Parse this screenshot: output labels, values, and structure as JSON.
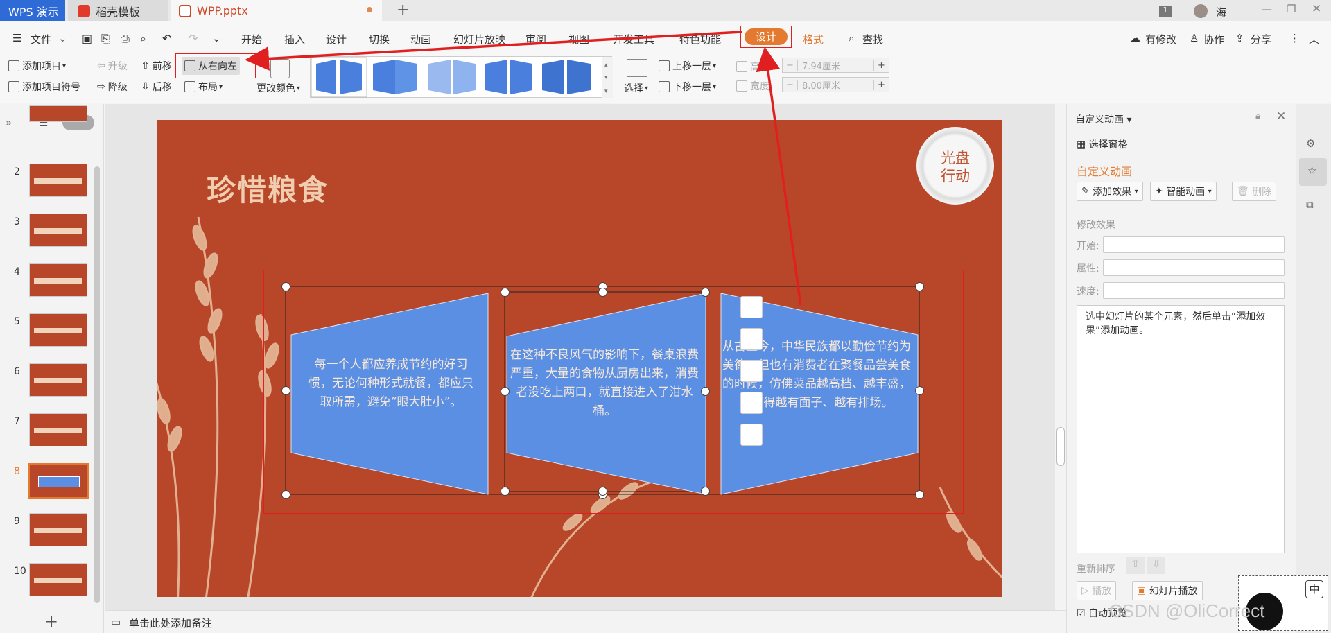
{
  "tabs": [
    {
      "label": "WPS 演示"
    },
    {
      "label": "稻壳模板"
    },
    {
      "label": "WPP.pptx"
    }
  ],
  "titlebar": {
    "counter": "1",
    "user": "海"
  },
  "menu": {
    "file": "文件",
    "items": [
      "开始",
      "插入",
      "设计",
      "切换",
      "动画",
      "幻灯片放映",
      "审阅",
      "视图",
      "开发工具",
      "特色功能"
    ],
    "active_design": "设计",
    "format": "格式",
    "search": "查找",
    "right": [
      "有修改",
      "协作",
      "分享"
    ]
  },
  "ribbon": {
    "add_item": "添加项目",
    "add_bullet": "添加项目符号",
    "upgrade": "升级",
    "downgrade": "降级",
    "forward": "前移",
    "backward": "后移",
    "rtl": "从右向左",
    "layout": "布局",
    "change_color": "更改颜色",
    "select": "选择",
    "up_layer": "上移一层",
    "down_layer": "下移一层",
    "height_label": "高度:",
    "height_value": "7.94厘米",
    "width_label": "宽度:",
    "width_value": "8.00厘米"
  },
  "slides": [
    {
      "num": ""
    },
    {
      "num": "2"
    },
    {
      "num": "3"
    },
    {
      "num": "4"
    },
    {
      "num": "5"
    },
    {
      "num": "6"
    },
    {
      "num": "7"
    },
    {
      "num": "8"
    },
    {
      "num": "9"
    },
    {
      "num": "10"
    }
  ],
  "active_slide": "8",
  "slide": {
    "title": "珍惜粮食",
    "badge_line1": "光盘",
    "badge_line2": "行动",
    "box1": "每一个人都应养成节约的好习惯，无论何种形式就餐，都应只取所需，避免“眼大肚小”。",
    "box2": "在这种不良风气的影响下，餐桌浪费严重，大量的食物从厨房出来，消费者没吃上两口，就直接进入了泔水桶。",
    "box3": "从古至今，中华民族都以勤俭节约为美德。但也有消费者在聚餐品尝美食的时候，仿佛菜品越高档、越丰盛，就显得越有面子、越有排场。"
  },
  "notes_placeholder": "单击此处添加备注",
  "panel": {
    "header": "自定义动画",
    "select_pane": "选择窗格",
    "section_title": "自定义动画",
    "add_effect": "添加效果",
    "smart_anim": "智能动画",
    "delete": "删除",
    "modify": "修改效果",
    "start": "开始:",
    "property": "属性:",
    "speed": "速度:",
    "hint": "选中幻灯片的某个元素，然后单击“添加效果”添加动画。",
    "reorder": "重新排序",
    "play": "播放",
    "slideshow": "幻灯片播放",
    "autopreview": "自动预览"
  },
  "ime": "中",
  "watermark": "CSDN @OliCorrect",
  "colors": {
    "accent": "#e37a30",
    "arrow": "#e02020",
    "slide_bg": "#b8472a",
    "shape": "#5b8fe3"
  }
}
